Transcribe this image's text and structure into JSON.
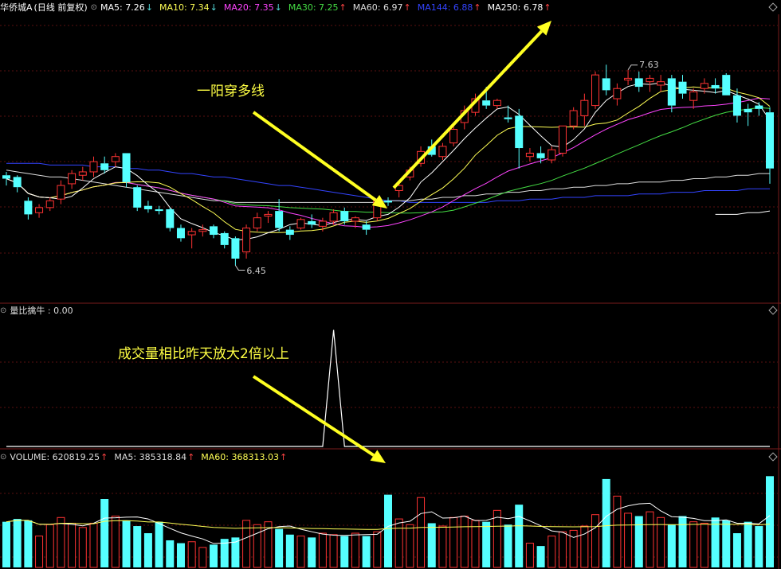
{
  "header": {
    "title": "华侨城A",
    "mode": "(日线 前复权)",
    "ma": [
      {
        "label": "MA5: 7.26",
        "arrow": "↓",
        "color": "#ffffff",
        "arrow_color": "#55dddd"
      },
      {
        "label": "MA10: 7.34",
        "arrow": "↓",
        "color": "#ffff55",
        "arrow_color": "#55dddd"
      },
      {
        "label": "MA20: 7.35",
        "arrow": "↓",
        "color": "#ff44ff",
        "arrow_color": "#55dddd"
      },
      {
        "label": "MA30: 7.25",
        "arrow": "↑",
        "color": "#44dd44",
        "arrow_color": "#ff4444"
      },
      {
        "label": "MA60: 6.97",
        "arrow": "↑",
        "color": "#dddddd",
        "arrow_color": "#ff4444"
      },
      {
        "label": "MA144: 6.88",
        "arrow": "↑",
        "color": "#3344ff",
        "arrow_color": "#ff4444"
      },
      {
        "label": "MA250: 6.78",
        "arrow": "↑",
        "color": "#ffffff",
        "arrow_color": "#ff4444"
      }
    ]
  },
  "indicator_header": {
    "label": "量比擒牛 : 0.00"
  },
  "volume_header": {
    "items": [
      {
        "label": "VOLUME: 620819.25",
        "arrow": "↑",
        "color": "#dddddd",
        "arrow_color": "#ff4444"
      },
      {
        "label": "MA5: 385318.84",
        "arrow": "↑",
        "color": "#dddddd",
        "arrow_color": "#ff4444"
      },
      {
        "label": "MA60: 368313.03",
        "arrow": "↑",
        "color": "#ffff55",
        "arrow_color": "#ff4444"
      }
    ]
  },
  "annotations": {
    "breakout": "一阳穿多线",
    "volume": "成交量相比昨天放大2倍以上",
    "high_label": "7.63",
    "low_label": "6.45"
  },
  "colors": {
    "up": "#ff3333",
    "down": "#55ffff",
    "arrow": "#ffff22"
  },
  "chart_data": [
    {
      "type": "candlestick",
      "name": "price",
      "ylim": [
        6.3,
        7.9
      ],
      "ohlc": [
        [
          7.01,
          7.03,
          6.95,
          6.99
        ],
        [
          7.0,
          7.01,
          6.91,
          6.94
        ],
        [
          6.86,
          6.88,
          6.75,
          6.78
        ],
        [
          6.79,
          6.84,
          6.76,
          6.82
        ],
        [
          6.82,
          6.88,
          6.8,
          6.86
        ],
        [
          6.87,
          6.98,
          6.84,
          6.95
        ],
        [
          6.96,
          7.04,
          6.93,
          7.02
        ],
        [
          7.01,
          7.06,
          6.98,
          7.03
        ],
        [
          7.03,
          7.12,
          7.0,
          7.09
        ],
        [
          7.08,
          7.12,
          7.02,
          7.04
        ],
        [
          7.09,
          7.14,
          7.06,
          7.12
        ],
        [
          7.14,
          7.14,
          6.94,
          6.97
        ],
        [
          6.94,
          6.95,
          6.8,
          6.82
        ],
        [
          6.83,
          6.86,
          6.79,
          6.81
        ],
        [
          6.81,
          6.83,
          6.78,
          6.8
        ],
        [
          6.81,
          6.82,
          6.68,
          6.7
        ],
        [
          6.7,
          6.72,
          6.62,
          6.64
        ],
        [
          6.66,
          6.7,
          6.58,
          6.68
        ],
        [
          6.68,
          6.72,
          6.65,
          6.69
        ],
        [
          6.71,
          6.72,
          6.64,
          6.66
        ],
        [
          6.67,
          6.68,
          6.58,
          6.6
        ],
        [
          6.64,
          6.65,
          6.48,
          6.52
        ],
        [
          6.56,
          6.72,
          6.52,
          6.7
        ],
        [
          6.7,
          6.79,
          6.68,
          6.76
        ],
        [
          6.77,
          6.8,
          6.73,
          6.78
        ],
        [
          6.8,
          6.87,
          6.68,
          6.7
        ],
        [
          6.69,
          6.71,
          6.63,
          6.66
        ],
        [
          6.7,
          6.76,
          6.69,
          6.75
        ],
        [
          6.74,
          6.78,
          6.7,
          6.72
        ],
        [
          6.71,
          6.76,
          6.68,
          6.74
        ],
        [
          6.74,
          6.81,
          6.72,
          6.79
        ],
        [
          6.8,
          6.82,
          6.72,
          6.74
        ],
        [
          6.74,
          6.77,
          6.7,
          6.76
        ],
        [
          6.72,
          6.74,
          6.66,
          6.69
        ],
        [
          6.76,
          6.87,
          6.74,
          6.86
        ],
        [
          6.86,
          6.88,
          6.83,
          6.85
        ],
        [
          6.92,
          6.96,
          6.88,
          6.95
        ],
        [
          7.0,
          7.06,
          6.98,
          7.04
        ],
        [
          7.08,
          7.18,
          7.06,
          7.15
        ],
        [
          7.18,
          7.22,
          7.12,
          7.13
        ],
        [
          7.12,
          7.2,
          7.1,
          7.18
        ],
        [
          7.2,
          7.31,
          7.18,
          7.28
        ],
        [
          7.32,
          7.42,
          7.28,
          7.39
        ],
        [
          7.38,
          7.49,
          7.36,
          7.46
        ],
        [
          7.45,
          7.53,
          7.4,
          7.42
        ],
        [
          7.42,
          7.46,
          7.4,
          7.45
        ],
        [
          7.35,
          7.42,
          7.32,
          7.34
        ],
        [
          7.36,
          7.4,
          7.05,
          7.17
        ],
        [
          7.12,
          7.17,
          7.09,
          7.14
        ],
        [
          7.14,
          7.18,
          7.08,
          7.11
        ],
        [
          7.1,
          7.18,
          7.08,
          7.16
        ],
        [
          7.14,
          7.3,
          7.12,
          7.3
        ],
        [
          7.3,
          7.41,
          7.28,
          7.39
        ],
        [
          7.36,
          7.49,
          7.3,
          7.45
        ],
        [
          7.42,
          7.62,
          7.4,
          7.6
        ],
        [
          7.58,
          7.66,
          7.48,
          7.51
        ],
        [
          7.46,
          7.55,
          7.42,
          7.52
        ],
        [
          7.57,
          7.63,
          7.54,
          7.58
        ],
        [
          7.58,
          7.62,
          7.5,
          7.53
        ],
        [
          7.56,
          7.6,
          7.5,
          7.58
        ],
        [
          7.54,
          7.6,
          7.5,
          7.56
        ],
        [
          7.58,
          7.6,
          7.38,
          7.42
        ],
        [
          7.56,
          7.6,
          7.46,
          7.49
        ],
        [
          7.45,
          7.52,
          7.4,
          7.5
        ],
        [
          7.52,
          7.58,
          7.49,
          7.55
        ],
        [
          7.54,
          7.58,
          7.49,
          7.52
        ],
        [
          7.6,
          7.61,
          7.48,
          7.48
        ],
        [
          7.48,
          7.52,
          7.32,
          7.36
        ],
        [
          7.4,
          7.43,
          7.3,
          7.38
        ],
        [
          7.42,
          7.44,
          7.36,
          7.4
        ],
        [
          7.38,
          7.41,
          6.96,
          7.05
        ]
      ],
      "extra_lines": {
        "MA60": [
          7.04,
          7.03,
          7.02,
          7.01,
          7.0,
          7.0,
          6.99,
          6.98,
          6.97,
          6.96,
          6.95,
          6.94,
          6.93,
          6.92,
          6.91,
          6.9,
          6.89,
          6.88,
          6.87,
          6.86,
          6.86,
          6.85,
          6.85,
          6.85,
          6.85,
          6.85,
          6.85,
          6.85,
          6.85,
          6.85,
          6.85,
          6.85,
          6.85,
          6.85,
          6.85,
          6.86,
          6.86,
          6.86,
          6.87,
          6.87,
          6.88,
          6.88,
          6.89,
          6.89,
          6.9,
          6.9,
          6.91,
          6.91,
          6.92,
          6.92,
          6.93,
          6.93,
          6.94,
          6.94,
          6.95,
          6.95,
          6.96,
          6.96,
          6.97,
          6.97,
          6.97,
          6.98,
          6.98,
          6.99,
          6.99,
          7.0,
          7.0,
          7.01,
          7.01,
          7.02,
          7.02
        ],
        "MA144": [
          7.08,
          7.08,
          7.08,
          7.08,
          7.07,
          7.07,
          7.07,
          7.07,
          7.06,
          7.06,
          7.06,
          7.05,
          7.05,
          7.04,
          7.04,
          7.03,
          7.02,
          7.02,
          7.01,
          7.0,
          7.0,
          6.99,
          6.98,
          6.97,
          6.96,
          6.95,
          6.95,
          6.94,
          6.93,
          6.92,
          6.91,
          6.9,
          6.89,
          6.88,
          6.87,
          6.86,
          6.86,
          6.85,
          6.85,
          6.85,
          6.85,
          6.85,
          6.85,
          6.85,
          6.85,
          6.86,
          6.86,
          6.86,
          6.87,
          6.87,
          6.87,
          6.88,
          6.88,
          6.88,
          6.89,
          6.89,
          6.89,
          6.89,
          6.9,
          6.9,
          6.9,
          6.91,
          6.91,
          6.91,
          6.92,
          6.92,
          6.92,
          6.92,
          6.93,
          6.93,
          6.93
        ],
        "MA250": [
          null,
          null,
          null,
          null,
          null,
          null,
          null,
          null,
          null,
          null,
          null,
          null,
          null,
          null,
          null,
          null,
          null,
          null,
          null,
          null,
          null,
          null,
          null,
          null,
          null,
          null,
          null,
          null,
          null,
          null,
          null,
          null,
          null,
          null,
          null,
          null,
          null,
          null,
          null,
          null,
          null,
          null,
          null,
          null,
          null,
          null,
          null,
          null,
          null,
          null,
          null,
          null,
          null,
          null,
          null,
          null,
          null,
          null,
          null,
          null,
          null,
          null,
          null,
          null,
          null,
          6.78,
          6.78,
          6.78,
          6.79,
          6.79,
          6.8
        ]
      },
      "high_index": 57,
      "low_index": 21
    },
    {
      "type": "line",
      "name": "量比擒牛",
      "values": [
        0,
        0,
        0,
        0,
        0,
        0,
        0,
        0,
        0,
        0,
        0,
        0,
        0,
        0,
        0,
        0,
        0,
        0,
        0,
        0,
        0,
        0,
        0,
        0,
        0,
        0,
        0,
        0,
        0,
        0,
        1,
        0,
        0,
        0,
        0,
        0,
        0,
        0,
        0,
        0,
        0,
        0,
        0,
        0,
        0,
        0,
        0,
        0,
        0,
        0,
        0,
        0,
        0,
        0,
        0,
        0,
        0,
        0,
        0,
        0,
        0,
        0,
        0,
        0,
        0,
        0,
        0,
        0,
        0,
        0,
        0
      ],
      "ylim": [
        0,
        1.1
      ]
    },
    {
      "type": "bar",
      "name": "VOLUME",
      "values": [
        320,
        340,
        330,
        220,
        300,
        350,
        310,
        280,
        310,
        480,
        360,
        330,
        290,
        240,
        320,
        190,
        170,
        180,
        140,
        160,
        200,
        210,
        330,
        300,
        320,
        270,
        230,
        220,
        210,
        240,
        230,
        220,
        240,
        220,
        250,
        510,
        340,
        300,
        490,
        310,
        290,
        350,
        360,
        330,
        320,
        400,
        300,
        440,
        170,
        150,
        220,
        250,
        260,
        290,
        370,
        620,
        500,
        380,
        360,
        390,
        350,
        300,
        360,
        320,
        310,
        350,
        330,
        240,
        320,
        290,
        640
      ],
      "ylim": [
        0,
        720
      ]
    }
  ]
}
